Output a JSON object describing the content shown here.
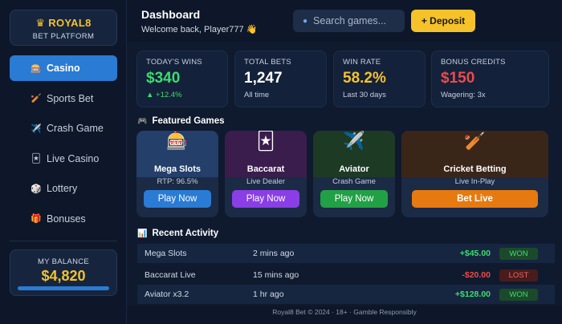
{
  "brand": {
    "name": "♛ ROYAL8",
    "tagline": "BET PLATFORM"
  },
  "nav": [
    {
      "label": "Casino",
      "icon": "🎰",
      "active": true
    },
    {
      "label": "Sports Bet",
      "icon": "🏏"
    },
    {
      "label": "Crash Game",
      "icon": "✈️"
    },
    {
      "label": "Live Casino",
      "icon": "🃏"
    },
    {
      "label": "Lottery",
      "icon": "🎲"
    },
    {
      "label": "Bonuses",
      "icon": "🎁"
    }
  ],
  "balance": {
    "label": "MY BALANCE",
    "value": "$4,820"
  },
  "header": {
    "title": "Dashboard",
    "welcome": "Welcome back, Player777 👋",
    "search_placeholder": "Search games...",
    "deposit_label": "+ Deposit"
  },
  "stats": [
    {
      "label": "TODAY'S WINS",
      "value": "$340",
      "sub": "▲ +12.4%",
      "color": "#3ddc6d",
      "sub_color": "#3ddc6d"
    },
    {
      "label": "TOTAL BETS",
      "value": "1,247",
      "sub": "All time",
      "color": "#ffffff"
    },
    {
      "label": "WIN RATE",
      "value": "58.2%",
      "sub": "Last 30 days",
      "color": "#f6c22a"
    },
    {
      "label": "BONUS CREDITS",
      "value": "$150",
      "sub": "Wagering: 3x",
      "color": "#ef4a4a"
    }
  ],
  "featured": {
    "title": "Featured Games",
    "icon": "🎮",
    "games": [
      {
        "title": "Mega Slots",
        "sub": "RTP: 96.5%",
        "button": "Play Now",
        "icon": "🎰",
        "top_color": "#233f6a",
        "btn_color": "#2a7bd4"
      },
      {
        "title": "Baccarat",
        "sub": "Live Dealer",
        "button": "Play Now",
        "icon": "🃏",
        "top_color": "#3a1d4d",
        "btn_color": "#8a3ee6"
      },
      {
        "title": "Aviator",
        "sub": "Crash Game",
        "button": "Play Now",
        "icon": "✈️",
        "top_color": "#1d3a25",
        "btn_color": "#22a045"
      },
      {
        "title": "Cricket Betting",
        "sub": "Live In-Play",
        "button": "Bet Live",
        "icon": "🏏",
        "top_color": "#3a2619",
        "btn_color": "#e67a10"
      }
    ]
  },
  "activity": {
    "title": "Recent Activity",
    "icon": "📊",
    "rows": [
      {
        "game": "Mega Slots",
        "time": "2 mins ago",
        "amount": "+$45.00",
        "status": "WON",
        "positive": true
      },
      {
        "game": "Baccarat Live",
        "time": "15 mins ago",
        "amount": "-$20.00",
        "status": "LOST",
        "positive": false
      },
      {
        "game": "Aviator x3.2",
        "time": "1 hr ago",
        "amount": "+$128.00",
        "status": "WON",
        "positive": true
      }
    ]
  },
  "footer": "Royal8 Bet © 2024 · 18+ · Gamble Responsibly"
}
